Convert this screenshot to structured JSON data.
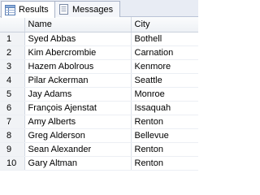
{
  "tabs": [
    {
      "label": "Results",
      "icon": "grid-results-icon",
      "active": true
    },
    {
      "label": "Messages",
      "icon": "messages-icon",
      "active": false
    }
  ],
  "grid": {
    "columns": [
      "",
      "Name",
      "City"
    ],
    "rows": [
      {
        "n": "1",
        "name": "Syed Abbas",
        "city": "Bothell"
      },
      {
        "n": "2",
        "name": "Kim Abercrombie",
        "city": "Carnation"
      },
      {
        "n": "3",
        "name": "Hazem Abolrous",
        "city": "Kenmore"
      },
      {
        "n": "4",
        "name": "Pilar Ackerman",
        "city": "Seattle"
      },
      {
        "n": "5",
        "name": "Jay Adams",
        "city": "Monroe"
      },
      {
        "n": "6",
        "name": "François Ajenstat",
        "city": "Issaquah"
      },
      {
        "n": "7",
        "name": "Amy Alberts",
        "city": "Renton"
      },
      {
        "n": "8",
        "name": "Greg Alderson",
        "city": "Bellevue"
      },
      {
        "n": "9",
        "name": "Sean Alexander",
        "city": "Renton"
      },
      {
        "n": "10",
        "name": "Gary Altman",
        "city": "Renton"
      }
    ]
  },
  "colors": {
    "tab_bg": "#e8ecf4",
    "header_bg": "#eef1f5",
    "rownum_bg": "#f1f3f6"
  }
}
